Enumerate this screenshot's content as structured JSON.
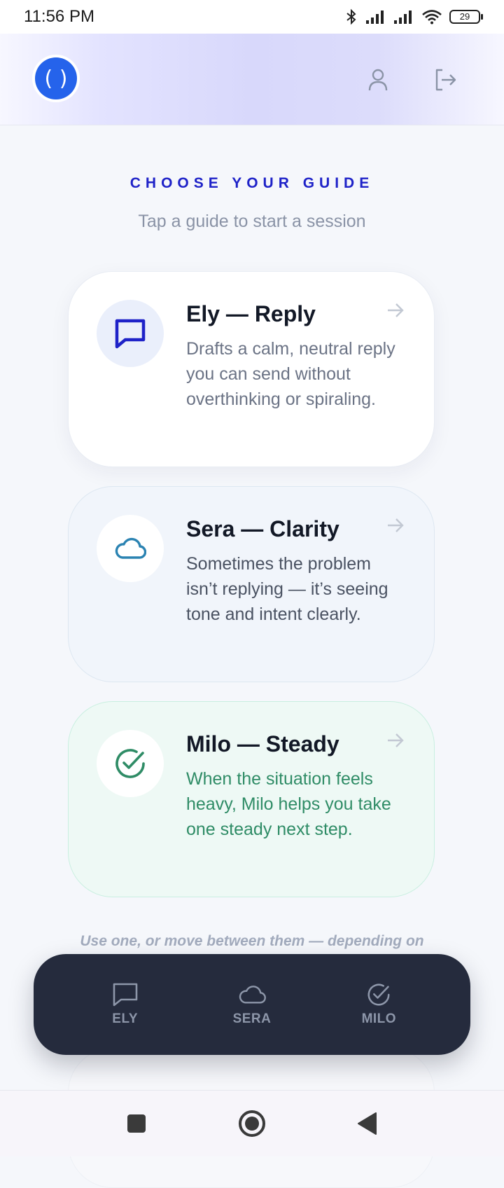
{
  "status_bar": {
    "time": "11:56 PM",
    "battery": "29",
    "icons": [
      "bluetooth-icon",
      "signal-icon",
      "signal-icon",
      "wifi-icon",
      "battery-icon"
    ]
  },
  "header": {
    "logo_glyph": "( )",
    "logo_color": "#2563eb",
    "actions": [
      "profile-icon",
      "logout-icon"
    ]
  },
  "main": {
    "eyebrow": "CHOOSE YOUR GUIDE",
    "subtitle": "Tap a guide to start a session",
    "guides": [
      {
        "title": "Ely — Reply",
        "description": "Drafts a calm, neutral reply you can send without overthinking or spiraling.",
        "icon": "chat-bubble-icon",
        "accent": "#1e22c8"
      },
      {
        "title": "Sera — Clarity",
        "description": "Sometimes the problem isn’t replying — it’s seeing tone and intent clearly.",
        "icon": "cloud-icon",
        "accent": "#2b83b2"
      },
      {
        "title": "Milo — Steady",
        "description": "When the situation feels heavy, Milo helps you take one steady next step.",
        "icon": "check-circle-icon",
        "accent": "#2f8c66"
      }
    ],
    "footer_note": "Use one, or move between them — depending on"
  },
  "tab_bar": {
    "tabs": [
      {
        "label": "ELY",
        "icon": "chat-bubble-icon"
      },
      {
        "label": "SERA",
        "icon": "cloud-icon"
      },
      {
        "label": "MILO",
        "icon": "check-circle-icon"
      }
    ]
  },
  "system_nav": {
    "buttons": [
      "recents-button",
      "home-button",
      "back-button"
    ]
  }
}
